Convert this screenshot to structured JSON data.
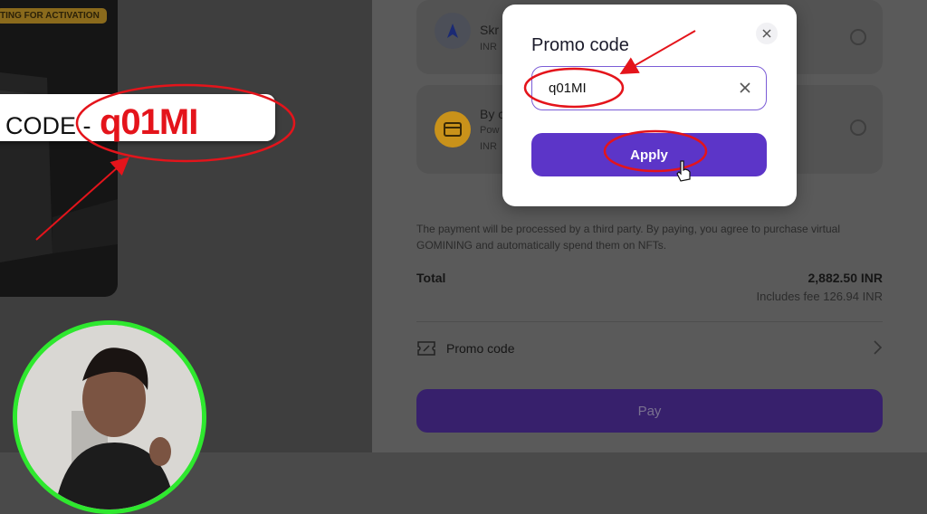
{
  "left": {
    "status_badge": "TING FOR ACTIVATION",
    "code_prefix": "CODE -",
    "code_value": "q01MI"
  },
  "payment_methods": [
    {
      "title": "Skr",
      "subtitle": "INR",
      "icon": "skrill-logo-icon"
    },
    {
      "title": "By c",
      "subtitle_line1": "Pow",
      "subtitle_line2": "INR",
      "icon": "card-icon"
    }
  ],
  "checkout": {
    "notice": "The payment will be processed by a third party. By paying, you agree to purchase virtual GOMINING and automatically spend them on NFTs.",
    "total_label": "Total",
    "total_value": "2,882.50 INR",
    "fee": "Includes fee 126.94 INR",
    "promo_label": "Promo code",
    "pay_label": "Pay"
  },
  "modal": {
    "title": "Promo code",
    "input_value": "q01MI",
    "apply_label": "Apply"
  },
  "colors": {
    "accent": "#5c35c8",
    "annotation": "#e4141b",
    "webcam_ring": "#2ee82e"
  }
}
